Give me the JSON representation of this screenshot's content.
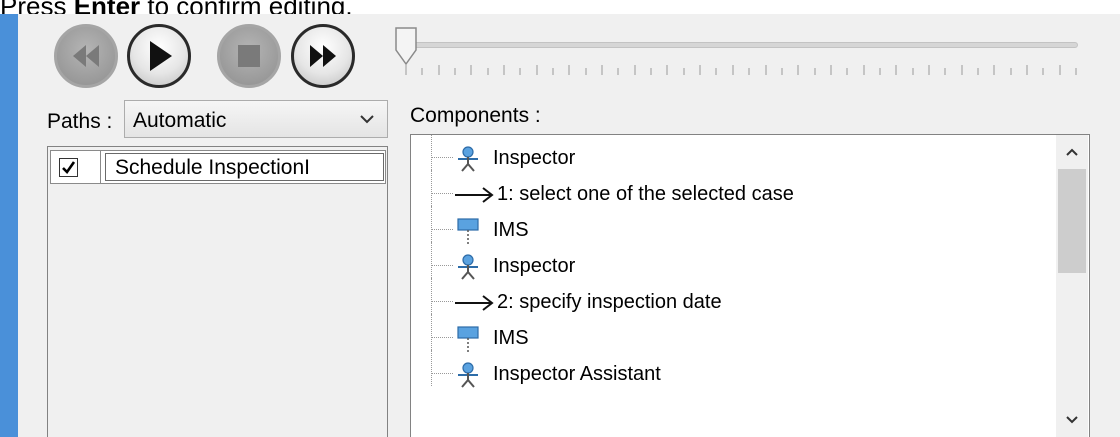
{
  "caption": {
    "prefix": "Press ",
    "key": "Enter",
    "suffix": " to confirm editing."
  },
  "player": {
    "buttons": [
      {
        "name": "rewind",
        "enabled": false
      },
      {
        "name": "play",
        "enabled": true
      },
      {
        "name": "stop",
        "enabled": false
      },
      {
        "name": "fast-forward",
        "enabled": true
      }
    ],
    "slider_value": 0
  },
  "paths": {
    "label": "Paths :",
    "selected": "Automatic",
    "items": [
      {
        "checked": true,
        "name": "Schedule InspectionI"
      }
    ]
  },
  "components": {
    "label": "Components :",
    "rows": [
      {
        "type": "actor",
        "icon": "actor-icon",
        "text": "Inspector"
      },
      {
        "type": "message",
        "icon": "arrow-icon",
        "text": "1: select one of the selected case"
      },
      {
        "type": "lifeline",
        "icon": "lifeline-icon",
        "text": "IMS"
      },
      {
        "type": "actor",
        "icon": "actor-icon",
        "text": "Inspector"
      },
      {
        "type": "message",
        "icon": "arrow-icon",
        "text": "2: specify inspection date"
      },
      {
        "type": "lifeline",
        "icon": "lifeline-icon",
        "text": "IMS"
      },
      {
        "type": "actor",
        "icon": "actor-icon",
        "text": "Inspector Assistant"
      }
    ]
  },
  "colors": {
    "accent_bar": "#4a90d9",
    "panel_bg": "#f0f0f0"
  }
}
